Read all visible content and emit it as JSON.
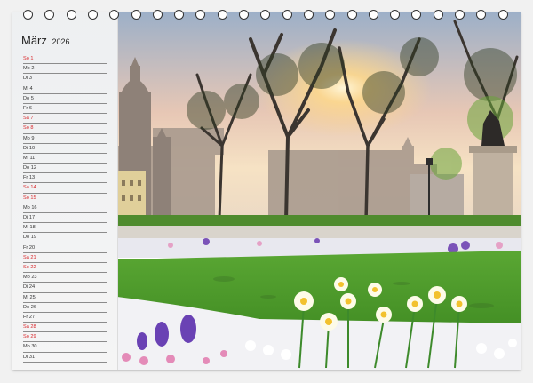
{
  "calendar": {
    "month": "März",
    "year": "2026",
    "days": [
      {
        "label": "So 1",
        "weekend": true
      },
      {
        "label": "Mo 2",
        "weekend": false
      },
      {
        "label": "Di 3",
        "weekend": false
      },
      {
        "label": "Mi 4",
        "weekend": false
      },
      {
        "label": "Do 5",
        "weekend": false
      },
      {
        "label": "Fr 6",
        "weekend": false
      },
      {
        "label": "Sa 7",
        "weekend": true
      },
      {
        "label": "So 8",
        "weekend": true
      },
      {
        "label": "Mo 9",
        "weekend": false
      },
      {
        "label": "Di 10",
        "weekend": false
      },
      {
        "label": "Mi 11",
        "weekend": false
      },
      {
        "label": "Do 12",
        "weekend": false
      },
      {
        "label": "Fr 13",
        "weekend": false
      },
      {
        "label": "Sa 14",
        "weekend": true
      },
      {
        "label": "So 15",
        "weekend": true
      },
      {
        "label": "Mo 16",
        "weekend": false
      },
      {
        "label": "Di 17",
        "weekend": false
      },
      {
        "label": "Mi 18",
        "weekend": false
      },
      {
        "label": "Do 19",
        "weekend": false
      },
      {
        "label": "Fr 20",
        "weekend": false
      },
      {
        "label": "Sa 21",
        "weekend": true
      },
      {
        "label": "So 22",
        "weekend": true
      },
      {
        "label": "Mo 23",
        "weekend": false
      },
      {
        "label": "Di 24",
        "weekend": false
      },
      {
        "label": "Mi 25",
        "weekend": false
      },
      {
        "label": "Do 26",
        "weekend": false
      },
      {
        "label": "Fr 27",
        "weekend": false
      },
      {
        "label": "Sa 28",
        "weekend": true
      },
      {
        "label": "So 29",
        "weekend": true
      },
      {
        "label": "Mo 30",
        "weekend": false
      },
      {
        "label": "Di 31",
        "weekend": false
      }
    ]
  },
  "binding": {
    "icon": "spiral-ring-icon",
    "ring_count": 23
  },
  "colors": {
    "weekend": "#d8262a",
    "weekday": "#333333",
    "lawn": "#4f9a2b"
  }
}
